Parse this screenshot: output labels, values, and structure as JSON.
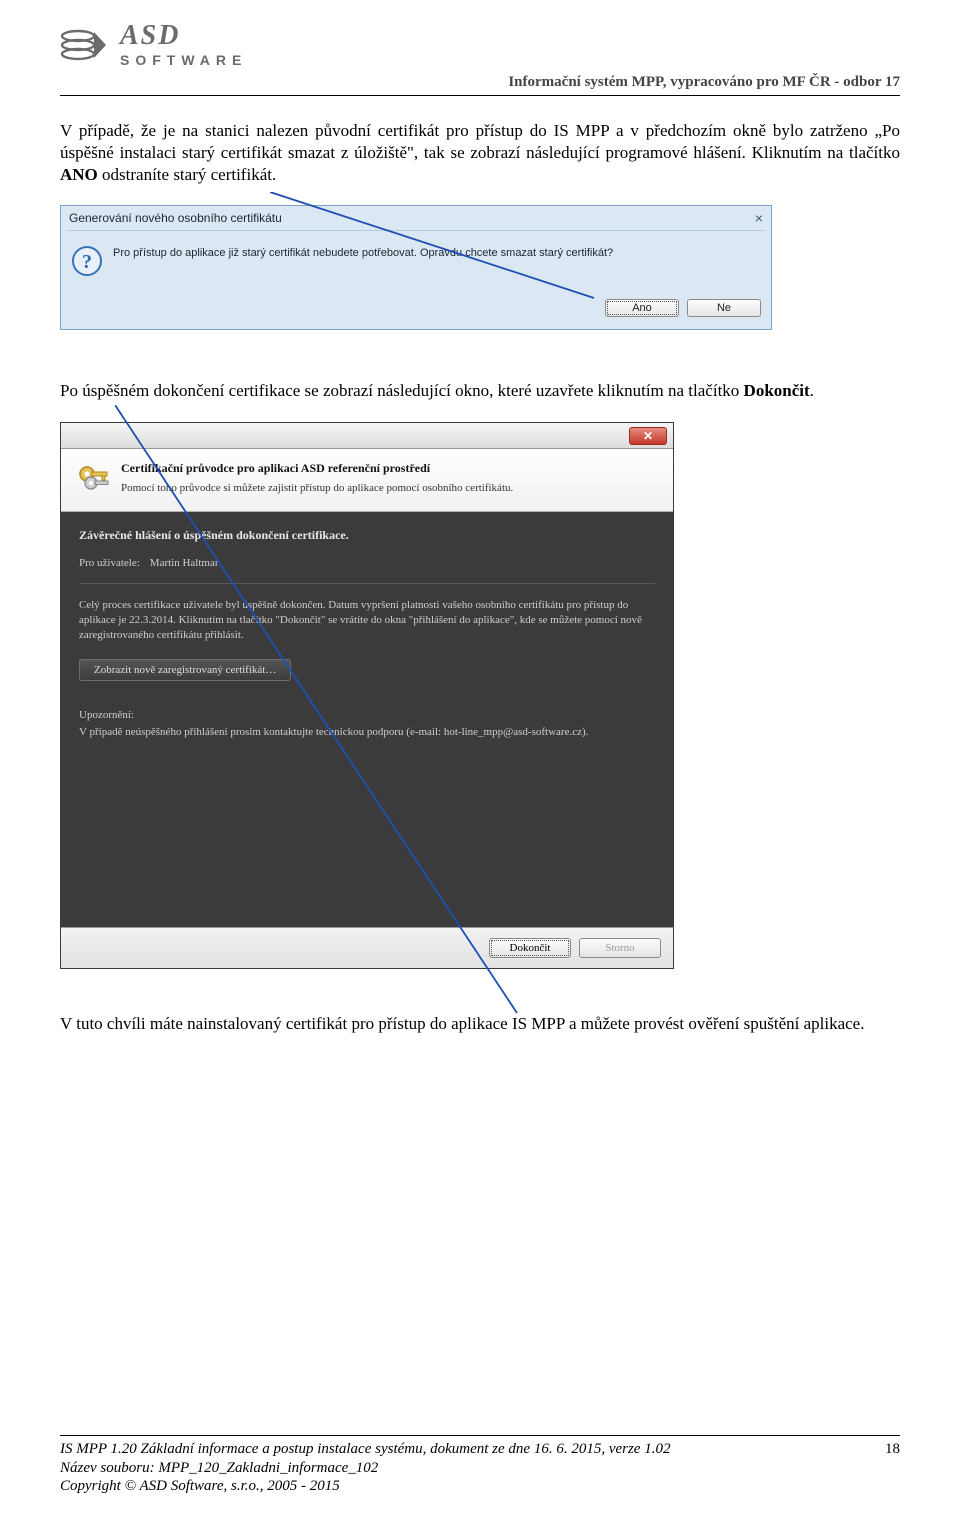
{
  "header": {
    "logo_top": "ASD",
    "logo_bottom": "SOFTWARE",
    "right": "Informační systém MPP, vypracováno pro MF ČR - odbor 17"
  },
  "para1": "V případě, že je na stanici nalezen původní certifikát pro přístup do IS MPP a v předchozím okně bylo zatrženo „Po úspěšné instalaci starý certifikát smazat z úložiště\", tak se zobrazí následující programové hlášení. Kliknutím na tlačítko ",
  "para1_b": "ANO",
  "para1_tail": " odstraníte starý certifikát.",
  "dlg1": {
    "title": "Generování nového osobního certifikátu",
    "close": "×",
    "msg": "Pro přístup do aplikace již starý certifikát nebudete potřebovat. Opravdu chcete smazat starý certifikát?",
    "btn_yes": "Ano",
    "btn_no": "Ne"
  },
  "para2": "Po úspěšném dokončení certifikace se zobrazí následující okno, které uzavřete kliknutím na tlačítko ",
  "para2_b": "Dokončit",
  "para2_tail": ".",
  "dlg2": {
    "head_title": "Certifikační průvodce pro aplikaci ASD referenční prostředí",
    "head_sub": "Pomocí toho průvodce si můžete zajistit přístup do aplikace pomocí osobního certifikátu.",
    "wz_h": "Závěrečné hlášení o úspěšném dokončení certifikace.",
    "user_label": "Pro uživatele:",
    "user_value": "Martin Haltmar",
    "body_p": "Celý proces certifikace uživatele byl úspěšně dokončen. Datum vypršení platnosti vašeho osobního certifikátu pro přístup do aplikace je 22.3.2014. Kliknutím na tlačítko \"Dokončit\" se vrátíte do okna \"přihlášení do aplikace\", kde se můžete pomocí nově zaregistrovaného certifikátu přihlásit.",
    "show_cert_btn": "Zobrazit nově zaregistrovaný certifikát…",
    "warn_h": "Upozornění:",
    "warn_p": "V případě neúspěšného přihlášení prosím kontaktujte technickou podporu (e-mail: hot-line_mpp@asd-software.cz).",
    "btn_finish": "Dokončit",
    "btn_cancel": "Storno"
  },
  "para3": "V tuto chvíli máte nainstalovaný certifikát pro přístup do aplikace IS MPP a můžete provést ověření spuštění aplikace.",
  "footer": {
    "l1": "IS MPP 1.20 Základní informace a postup instalace systému, dokument ze dne 16. 6. 2015, verze 1.02",
    "l2": "Název souboru: MPP_120_Zakladni_informace_102",
    "l3": "Copyright © ASD Software, s.r.o., 2005 - 2015",
    "page": "18"
  }
}
